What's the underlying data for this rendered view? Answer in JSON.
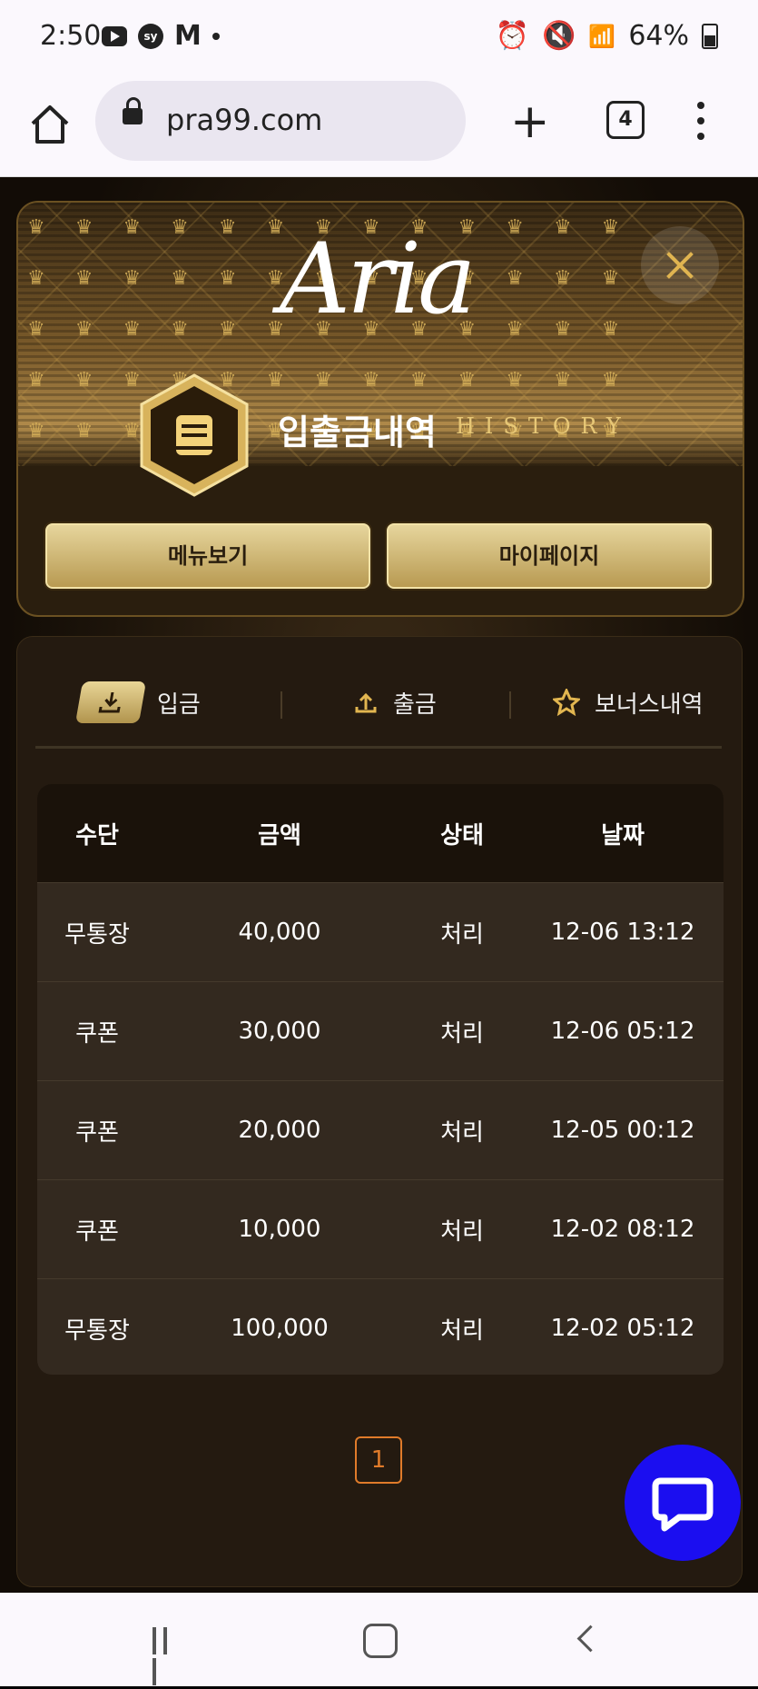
{
  "status_bar": {
    "time": "2:50",
    "battery": "64%"
  },
  "browser": {
    "url": "pra99.com",
    "tab_count": "4"
  },
  "header": {
    "logo": "Aria",
    "title": "입출금내역",
    "subtitle": "HISTORY",
    "menu_button": "메뉴보기",
    "mypage_button": "마이페이지"
  },
  "tabs": [
    {
      "label": "입금",
      "icon": "download-icon",
      "active": true
    },
    {
      "label": "출금",
      "icon": "upload-icon",
      "active": false
    },
    {
      "label": "보너스내역",
      "icon": "star-icon",
      "active": false
    }
  ],
  "table": {
    "headers": [
      "수단",
      "금액",
      "상태",
      "날짜"
    ],
    "rows": [
      [
        "무통장",
        "40,000",
        "처리",
        "12-06 13:12"
      ],
      [
        "쿠폰",
        "30,000",
        "처리",
        "12-06 05:12"
      ],
      [
        "쿠폰",
        "20,000",
        "처리",
        "12-05 00:12"
      ],
      [
        "쿠폰",
        "10,000",
        "처리",
        "12-02 08:12"
      ],
      [
        "무통장",
        "100,000",
        "처리",
        "12-02 05:12"
      ]
    ]
  },
  "pagination": {
    "current": "1"
  },
  "colors": {
    "gold": "#d9b25a",
    "chat": "#1b0ef0",
    "pager": "#e07b2a"
  }
}
